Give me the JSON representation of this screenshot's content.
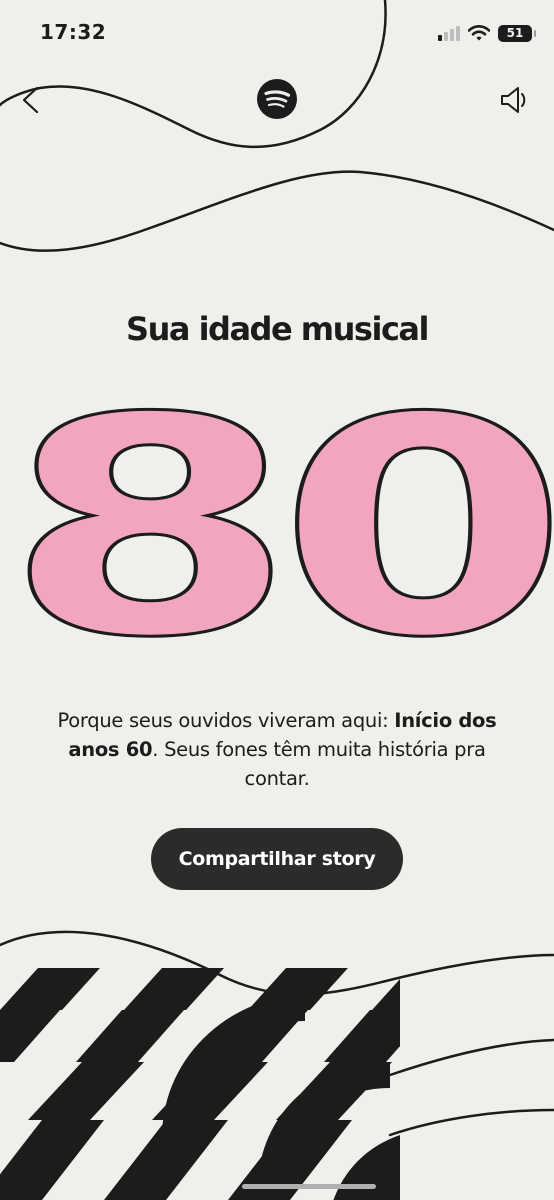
{
  "status": {
    "time": "17:32",
    "battery": "51",
    "signal_icon": "cellular-signal-icon",
    "wifi_icon": "wifi-icon"
  },
  "nav": {
    "back_icon": "chevron-left-icon",
    "logo_icon": "spotify-logo-icon",
    "sound_icon": "speaker-icon"
  },
  "title": "Sua idade musical",
  "age_number": "80",
  "description": {
    "part1": "Porque seus ouvidos viveram aqui: ",
    "bold": "Início dos anos 60",
    "part2": ". Seus fones têm muita história pra contar."
  },
  "share_button": "Compartilhar story",
  "colors": {
    "background": "#efefeb",
    "number_fill": "#f2a5c0",
    "dark": "#1c1c1c",
    "button": "#2b2b2b"
  }
}
